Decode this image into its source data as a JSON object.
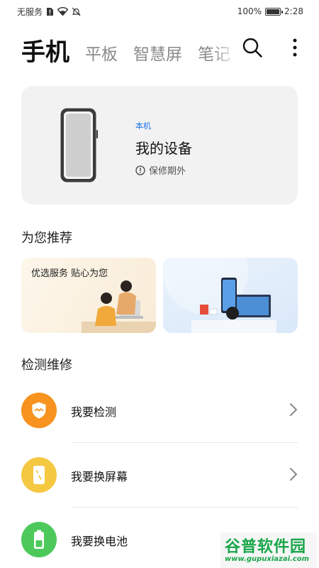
{
  "status_bar": {
    "carrier": "无服务",
    "battery": "100%",
    "battery_level": 1.0,
    "time": "2:28"
  },
  "tabs": [
    {
      "label": "手机",
      "active": true
    },
    {
      "label": "平板",
      "active": false
    },
    {
      "label": "智慧屏",
      "active": false
    },
    {
      "label": "笔记",
      "active": false
    }
  ],
  "actions": {
    "search_icon": "search-icon",
    "more_icon": "more-vertical-icon"
  },
  "device": {
    "tag": "本机",
    "name": "我的设备",
    "warranty": "保修期外",
    "warranty_icon": "info-icon"
  },
  "recommend": {
    "title": "为您推荐",
    "cards": [
      {
        "text": "优选服务 贴心为您"
      },
      {
        "text": ""
      }
    ]
  },
  "repair": {
    "title": "检测维修",
    "items": [
      {
        "label": "我要检测",
        "icon": "shield-check-icon",
        "color": "#f7931e"
      },
      {
        "label": "我要换屏幕",
        "icon": "phone-screen-icon",
        "color": "#f5c842"
      },
      {
        "label": "我要换电池",
        "icon": "battery-icon",
        "color": "#4cc95a"
      }
    ]
  },
  "watermark": {
    "title": "谷普软件园",
    "url": "www.gupuxiazai.com"
  },
  "colors": {
    "accent": "#1a73e8",
    "card_bg": "#f2f2f2"
  }
}
